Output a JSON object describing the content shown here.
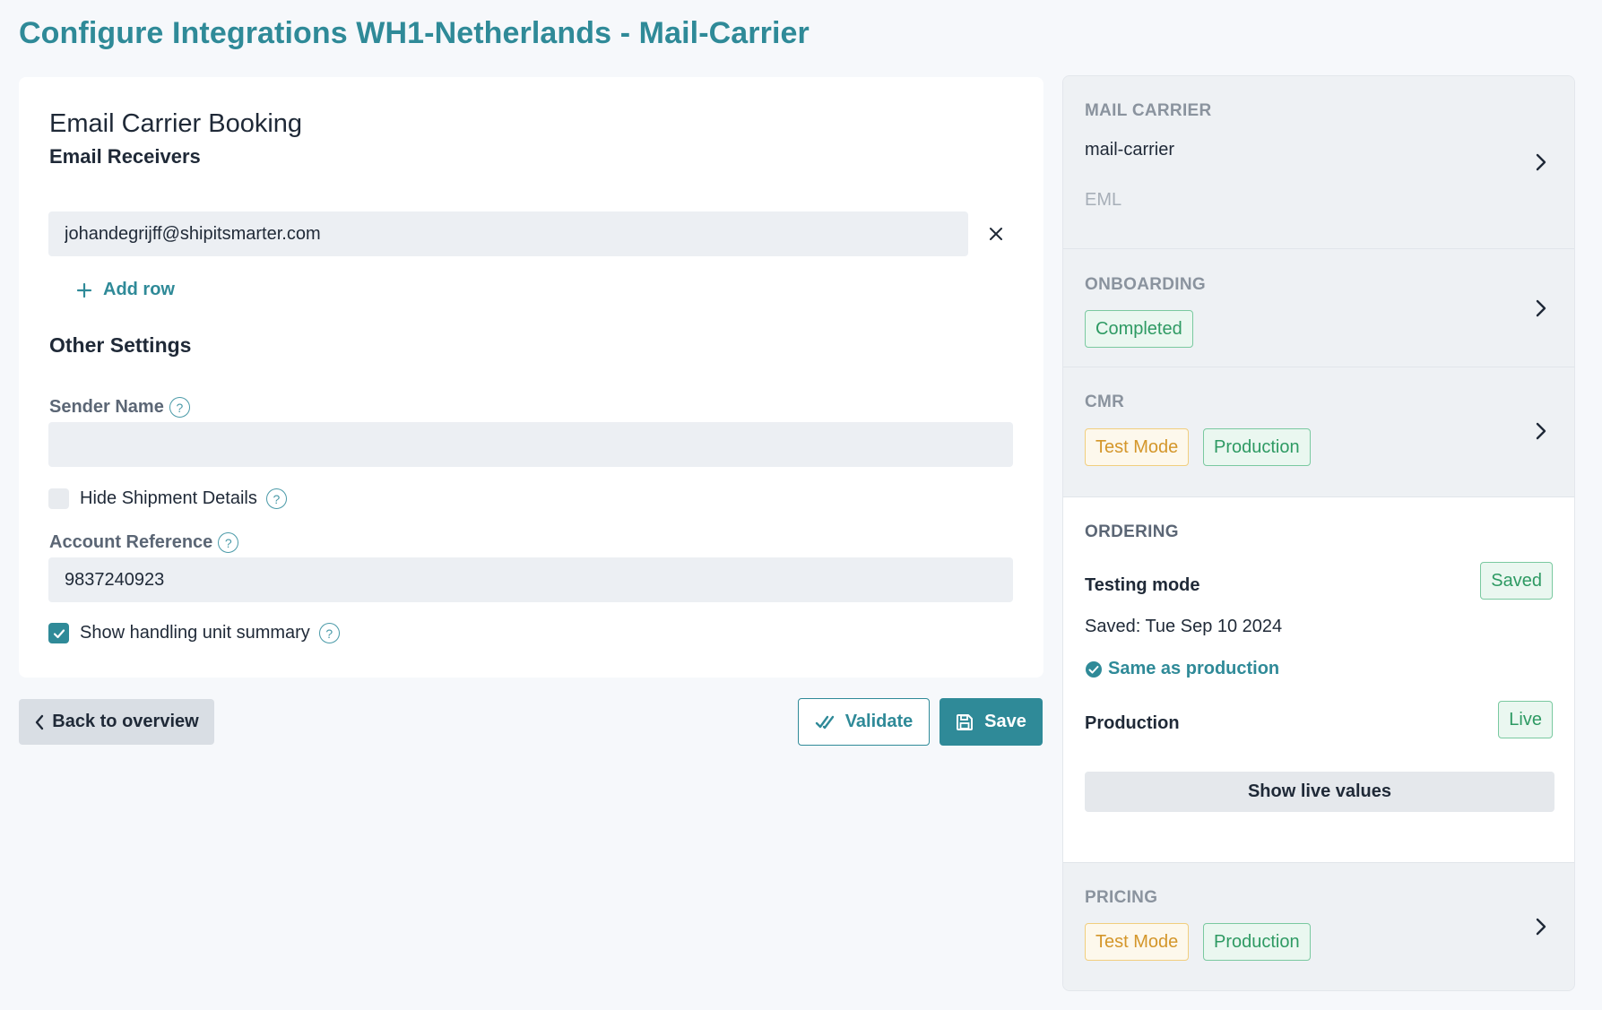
{
  "page": {
    "title": "Configure Integrations WH1-Netherlands - Mail-Carrier"
  },
  "form": {
    "title": "Email Carrier Booking",
    "email_receivers_label": "Email Receivers",
    "email_value": "johandegrijff@shipitsmarter.com",
    "add_row_label": "Add row",
    "other_settings_label": "Other Settings",
    "sender_name_label": "Sender Name",
    "sender_name_value": "",
    "hide_shipment_label": "Hide Shipment Details",
    "hide_shipment_checked": false,
    "account_reference_label": "Account Reference",
    "account_reference_value": "9837240923",
    "handling_summary_label": "Show handling unit summary",
    "handling_summary_checked": true,
    "help_glyph": "?"
  },
  "actions": {
    "back_label": "Back to overview",
    "validate_label": "Validate",
    "save_label": "Save"
  },
  "panel": {
    "mail_carrier": {
      "heading": "MAIL CARRIER",
      "name": "mail-carrier",
      "code": "EML"
    },
    "onboarding": {
      "heading": "ONBOARDING",
      "status": "Completed"
    },
    "cmr": {
      "heading": "CMR",
      "test_badge": "Test Mode",
      "prod_badge": "Production"
    },
    "ordering": {
      "heading": "ORDERING",
      "testing_label": "Testing mode",
      "testing_badge": "Saved",
      "saved_text": "Saved: Tue Sep 10 2024",
      "same_as_label": "Same as production",
      "production_label": "Production",
      "production_badge": "Live",
      "show_live_label": "Show live values"
    },
    "pricing": {
      "heading": "PRICING",
      "test_badge": "Test Mode",
      "prod_badge": "Production"
    }
  },
  "colors": {
    "accent": "#2f8a98",
    "badge_green": "#2e9a63",
    "badge_yellow": "#d4962a",
    "background": "#f6f8fb"
  }
}
